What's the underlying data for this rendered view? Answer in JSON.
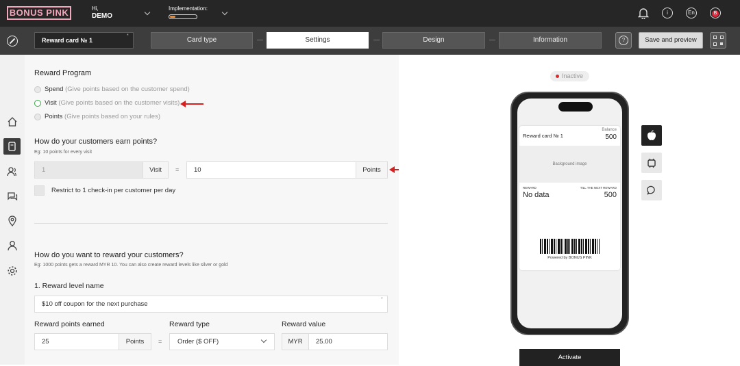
{
  "topbar": {
    "logo": "BONUS PINK",
    "greeting": "Hi,",
    "user": "DEMO",
    "implementation_label": "Implementation:",
    "implementation_progress": 0.2,
    "language": "En",
    "avatar": "B",
    "icons": [
      "bell-icon",
      "info-icon",
      "language-icon",
      "avatar-icon"
    ]
  },
  "toolbar": {
    "card_name": "Reward card № 1",
    "steps": [
      "Card type",
      "Settings",
      "Design",
      "Information"
    ],
    "active_step": "Settings",
    "help": "?",
    "save_label": "Save and preview"
  },
  "sidebar": {
    "items": [
      "home-icon",
      "card-icon",
      "users-icon",
      "chat-icon",
      "location-icon",
      "person-icon",
      "settings-icon"
    ]
  },
  "form": {
    "reward_program_title": "Reward Program",
    "options": [
      {
        "name": "Spend",
        "hint": "(Give points based on the customer spend)"
      },
      {
        "name": "Visit",
        "hint": "(Give points based on the customer visits)"
      },
      {
        "name": "Points",
        "hint": "(Give points based on your rules)"
      }
    ],
    "selected_option": "Visit",
    "earn_title": "How do your customers earn points?",
    "earn_example": "Eg: 10 points for every visit",
    "visit_value": "1",
    "visit_unit": "Visit",
    "equals": "=",
    "points_value": "10",
    "points_unit": "Points",
    "restrict_label": "Restrict to 1 check-in per customer per day",
    "reward_title": "How do you want to reward your customers?",
    "reward_example": "Eg: 1000 points gets a reward MYR 10. You can also create reward levels like silver or gold",
    "level_name_label": "1. Reward level name",
    "level_name_value": "$10 off coupon for the next purchase",
    "points_earned_label": "Reward points earned",
    "points_earned_value": "25",
    "points_earned_unit": "Points",
    "reward_type_label": "Reward type",
    "reward_type_value": "Order ($ OFF)",
    "reward_value_label": "Reward value",
    "currency": "MYR",
    "reward_value": "25.00"
  },
  "preview": {
    "status": "Inactive",
    "card_title": "Reward card № 1",
    "balance_label": "Balance",
    "balance_value": "500",
    "background_text": "Background image",
    "reward_label": "REWARD",
    "reward_value": "No data",
    "next_label": "TILL THE NEXT REWARD",
    "next_value": "500",
    "powered": "Powered by BONUS PINK",
    "device_icons": [
      "apple-icon",
      "android-icon",
      "chat-bubble-icon"
    ],
    "activate_label": "Activate"
  }
}
